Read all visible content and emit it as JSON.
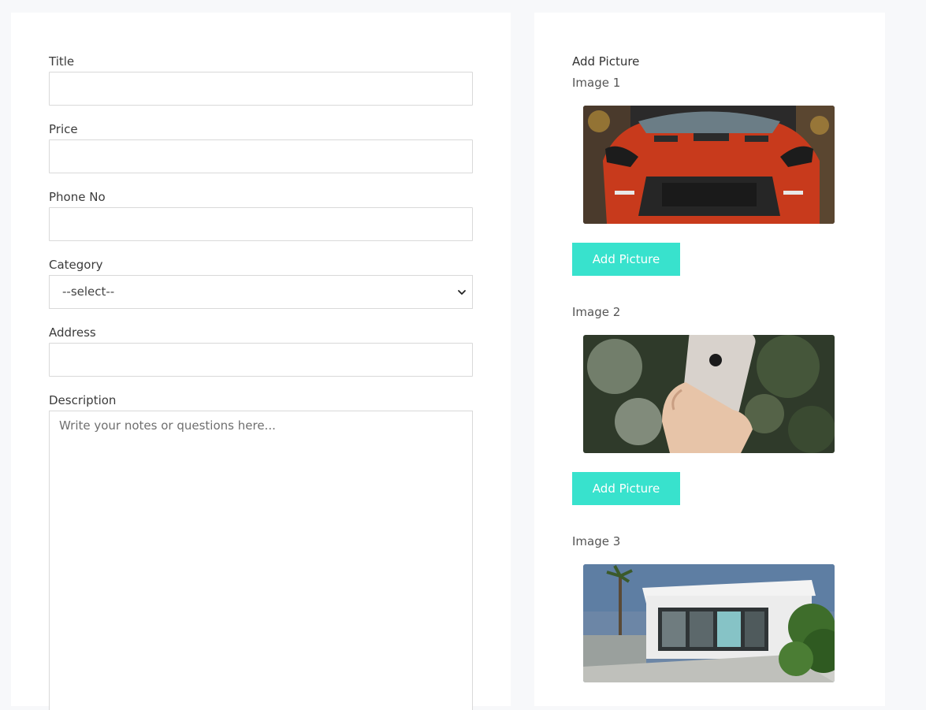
{
  "form": {
    "title_label": "Title",
    "title_value": "",
    "price_label": "Price",
    "price_value": "",
    "phone_label": "Phone No",
    "phone_value": "",
    "category_label": "Category",
    "category_selected": "--select--",
    "address_label": "Address",
    "address_value": "",
    "description_label": "Description",
    "description_placeholder": "Write your notes or questions here..."
  },
  "pictures": {
    "heading": "Add Picture",
    "items": [
      {
        "label": "Image 1",
        "button": "Add Picture",
        "subject": "red sports car front"
      },
      {
        "label": "Image 2",
        "button": "Add Picture",
        "subject": "hand holding phone"
      },
      {
        "label": "Image 3",
        "button": "",
        "subject": "modern white house"
      }
    ]
  },
  "colors": {
    "accent": "#38e2cd",
    "background": "#f7f8fa",
    "border": "#d9d9d9"
  }
}
